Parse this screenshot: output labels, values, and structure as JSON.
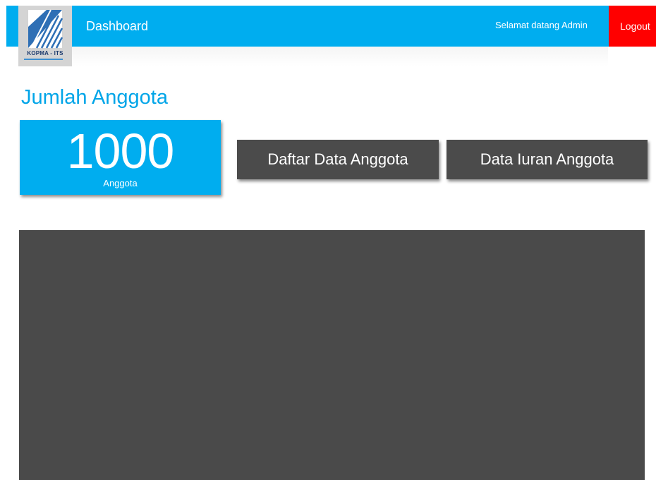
{
  "header": {
    "logo_text": "KOPMA - ITS",
    "title": "Dashboard",
    "welcome": "Selamat datang Admin",
    "logout_label": "Logout"
  },
  "main": {
    "heading": "Jumlah Anggota",
    "stat": {
      "value": "1000",
      "label": "Anggota"
    },
    "buttons": {
      "daftar_label": "Daftar Data Anggota",
      "iuran_label": "Data Iuran Anggota"
    }
  },
  "colors": {
    "primary": "#00adef",
    "logout": "#ff0000",
    "button": "#4b4b4b",
    "panel": "#4a4a4a",
    "heading": "#00a5e8"
  }
}
